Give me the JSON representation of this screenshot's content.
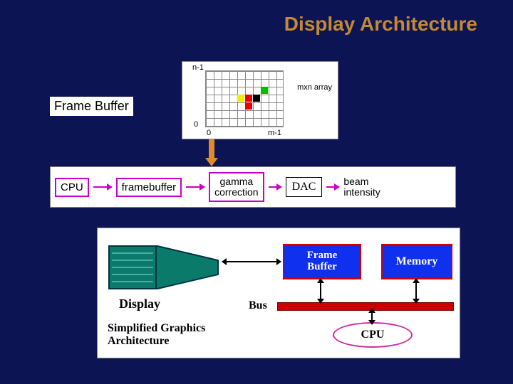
{
  "title": "Display Architecture",
  "labels": {
    "frame_buffer": "Frame Buffer"
  },
  "panel1": {
    "y_top": "n-1",
    "y_bottom": "0",
    "x_left": "0",
    "x_right": "m-1",
    "array_label": "mxn array"
  },
  "pipeline": {
    "cpu": "CPU",
    "framebuffer": "framebuffer",
    "gamma": "gamma\ncorrection",
    "dac": "DAC",
    "beam": "beam\nintensity"
  },
  "panel3": {
    "display": "Display",
    "frame_buffer_box": "Frame\nBuffer",
    "memory": "Memory",
    "bus": "Bus",
    "cpu": "CPU",
    "sga": "Simplified Graphics\nArchitecture"
  }
}
